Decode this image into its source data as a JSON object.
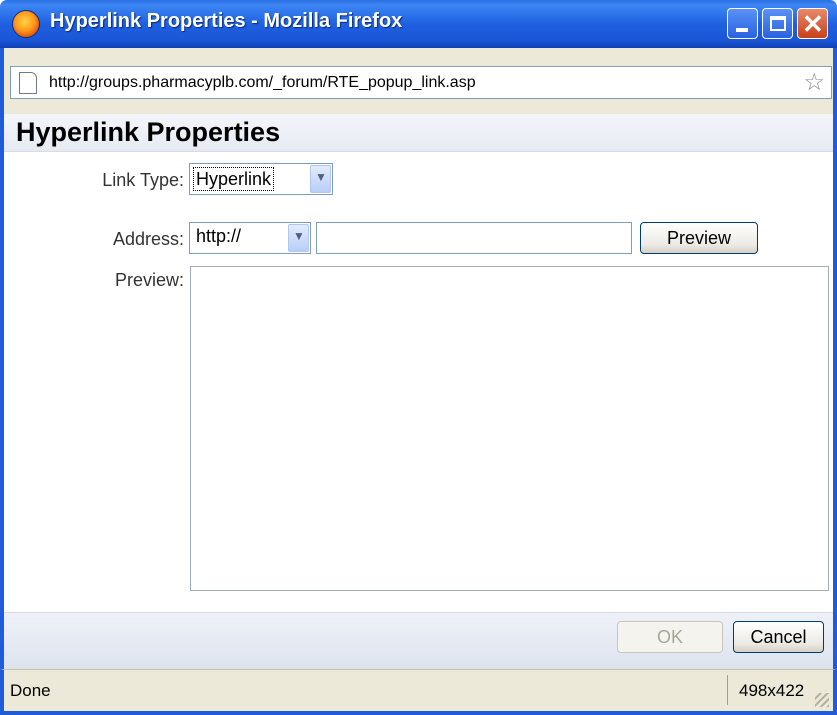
{
  "window": {
    "title": "Hyperlink Properties - Mozilla Firefox",
    "colors": {
      "titlebar": "#1f60e0",
      "close": "#c8401c"
    }
  },
  "browser": {
    "url": "http://groups.pharmacyplb.com/_forum/RTE_popup_link.asp",
    "page_icon": "page-icon",
    "bookmark_icon": "star-icon"
  },
  "dialog": {
    "heading": "Hyperlink Properties",
    "link_type": {
      "label": "Link Type:",
      "value": "Hyperlink"
    },
    "address": {
      "label": "Address:",
      "protocol": "http://",
      "value": "",
      "preview_button": "Preview"
    },
    "preview": {
      "label": "Preview:"
    },
    "buttons": {
      "ok": "OK",
      "cancel": "Cancel"
    }
  },
  "status": {
    "text": "Done",
    "dimensions": "498x422"
  }
}
